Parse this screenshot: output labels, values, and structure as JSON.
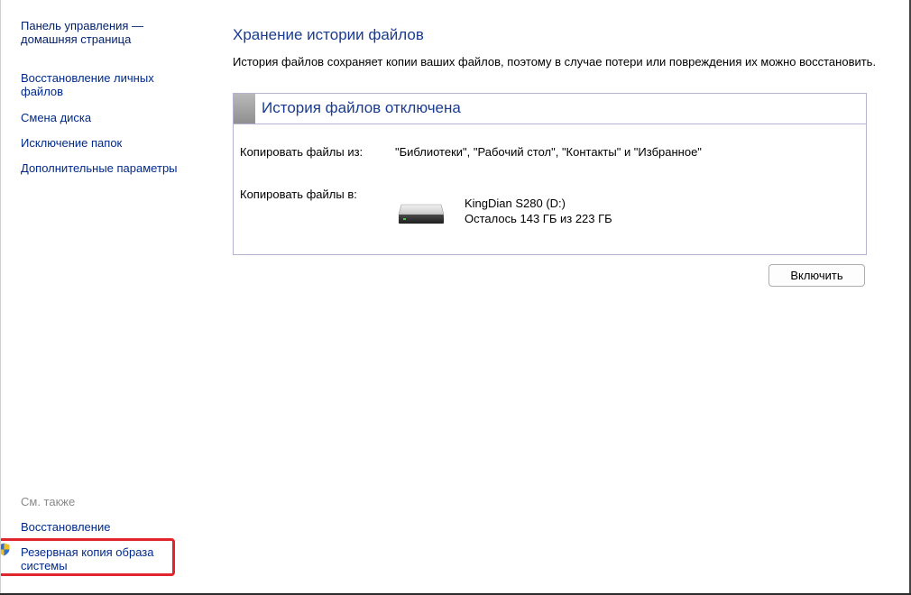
{
  "nav": {
    "home": "Панель управления — домашняя страница",
    "restore_personal_files": "Восстановление личных файлов",
    "change_disk": "Смена диска",
    "exclude_folders": "Исключение папок",
    "advanced_settings": "Дополнительные параметры"
  },
  "see_also": {
    "heading": "См. также",
    "recovery": "Восстановление",
    "system_image_backup": "Резервная копия образа системы"
  },
  "main": {
    "title": "Хранение истории файлов",
    "description": "История файлов сохраняет копии ваших файлов, поэтому в случае потери или повреждения их можно восстановить."
  },
  "status_panel": {
    "title": "История файлов отключена",
    "copy_from_label": "Копировать файлы из:",
    "copy_from_value": "\"Библиотеки\", \"Рабочий стол\", \"Контакты\" и \"Избранное\"",
    "copy_to_label": "Копировать файлы в:",
    "drive_name": "KingDian S280 (D:)",
    "drive_space": "Осталось 143 ГБ из 223 ГБ"
  },
  "actions": {
    "enable_label": "Включить"
  },
  "colors": {
    "link": "#002a8a",
    "title": "#1a3b8f",
    "highlight": "#e0262c",
    "panel_border": "#b4b4d2"
  },
  "icons": {
    "shield": "uac-shield-icon",
    "drive": "hard-drive-icon"
  }
}
